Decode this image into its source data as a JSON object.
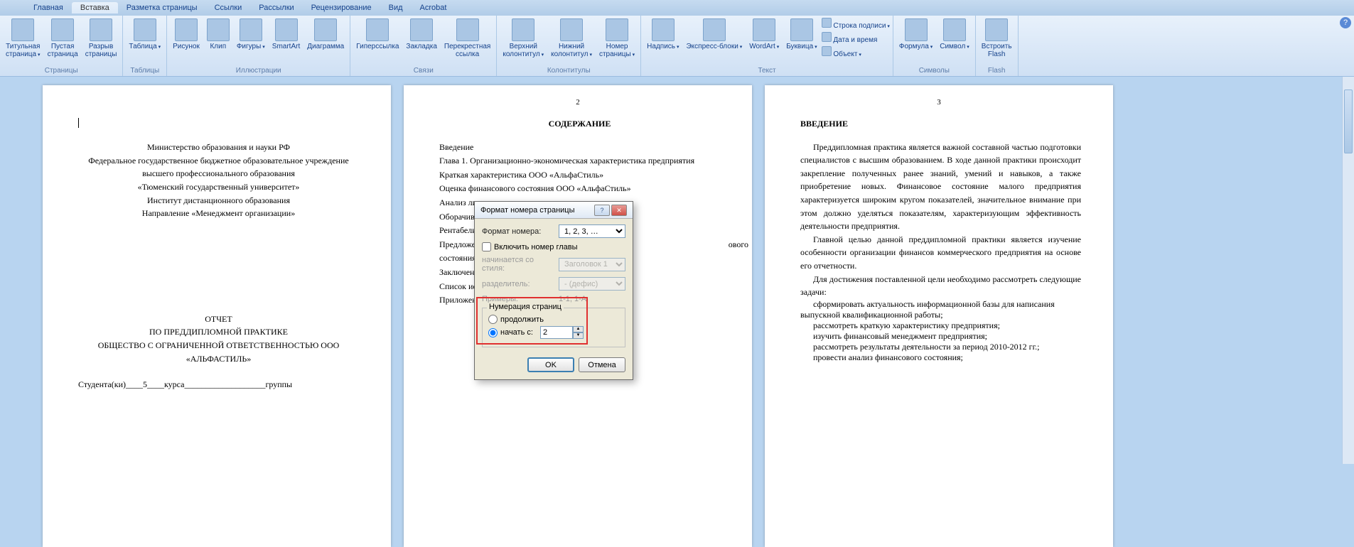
{
  "tabs": [
    "Главная",
    "Вставка",
    "Разметка страницы",
    "Ссылки",
    "Рассылки",
    "Рецензирование",
    "Вид",
    "Acrobat"
  ],
  "active_tab": 1,
  "ribbon": {
    "pages": {
      "label": "Страницы",
      "items": [
        "Титульная\nстраница",
        "Пустая\nстраница",
        "Разрыв\nстраницы"
      ]
    },
    "tables": {
      "label": "Таблицы",
      "items": [
        "Таблица"
      ]
    },
    "illus": {
      "label": "Иллюстрации",
      "items": [
        "Рисунок",
        "Клип",
        "Фигуры",
        "SmartArt",
        "Диаграмма"
      ]
    },
    "links": {
      "label": "Связи",
      "items": [
        "Гиперссылка",
        "Закладка",
        "Перекрестная\nссылка"
      ]
    },
    "hf": {
      "label": "Колонтитулы",
      "items": [
        "Верхний\nколонтитул",
        "Нижний\nколонтитул",
        "Номер\nстраницы"
      ]
    },
    "text": {
      "label": "Текст",
      "items": [
        "Надпись",
        "Экспресс-блоки",
        "WordArt",
        "Буквица"
      ],
      "side": [
        "Строка подписи",
        "Дата и время",
        "Объект"
      ]
    },
    "symbols": {
      "label": "Символы",
      "items": [
        "Формула",
        "Символ"
      ]
    },
    "flash": {
      "label": "Flash",
      "items": [
        "Встроить\nFlash"
      ]
    }
  },
  "page1": {
    "lines": [
      "Министерство образования и науки РФ",
      "Федеральное государственное бюджетное образовательное учреждение",
      "высшего профессионального образования",
      "«Тюменский государственный университет»",
      "Институт дистанционного образования",
      "Направление «Менеджмент организации»"
    ],
    "report_lines": [
      "ОТЧЕТ",
      "ПО ПРЕДДИПЛОМНОЙ ПРАКТИКЕ",
      "ОБЩЕСТВО С ОГРАНИЧЕННОЙ ОТВЕТСТВЕННОСТЬЮ ООО",
      "«АЛЬФАСТИЛЬ»"
    ],
    "student_line": "Студента(ки)____5____курса___________________группы"
  },
  "page2": {
    "num": "2",
    "title": "СОДЕРЖАНИЕ",
    "toc": [
      "Введение",
      "Глава 1. Организационно-экономическая характеристика предприятия",
      "Краткая характеристика ООО «АльфаСтиль»",
      "Оценка финансового состояния ООО «АльфаСтиль»",
      "Анализ ли",
      "Оборачива",
      "Рентабель",
      "Предложе",
      "состояния",
      "Заключени",
      "Список ис",
      "Приложен"
    ],
    "toc_tail": "ового"
  },
  "page3": {
    "num": "3",
    "title": "ВВЕДЕНИЕ",
    "paras": [
      "Преддипломная практика является важной составной частью подготовки специалистов с высшим образованием. В ходе данной практики происходит закрепление полученных ранее знаний, умений и навыков, а также приобретение новых. Финансовое состояние малого предприятия характеризуется широким кругом показателей, значительное внимание при этом должно уделяться показателям, характеризующим эффективность деятельности предприятия.",
      "Главной целью данной преддипломной практики является изучение особенности организации финансов коммерческого предприятия на основе его отчетности.",
      "Для достижения поставленной цели необходимо рассмотреть следующие задачи:"
    ],
    "bullets": [
      "сформировать актуальность информационной базы для написания выпускной квалификационной работы;",
      "рассмотреть краткую характеристику предприятия;",
      "изучить финансовый менеджмент предприятия;",
      "рассмотреть результаты деятельности за период 2010-2012 гг.;",
      "провести анализ финансового состояния;"
    ]
  },
  "dialog": {
    "title": "Формат номера страницы",
    "fmt_label": "Формат номера:",
    "fmt_value": "1, 2, 3, …",
    "include_chapter": "Включить номер главы",
    "start_style_label": "начинается со стиля:",
    "start_style_value": "Заголовок 1",
    "sep_label": "разделитель:",
    "sep_value": "-   (дефис)",
    "examples_label": "Примеры:",
    "examples_value": "1-1, 1-A",
    "numbering_label": "Нумерация страниц",
    "continue": "продолжить",
    "start_from": "начать с:",
    "start_from_value": "2",
    "ok": "OK",
    "cancel": "Отмена"
  }
}
